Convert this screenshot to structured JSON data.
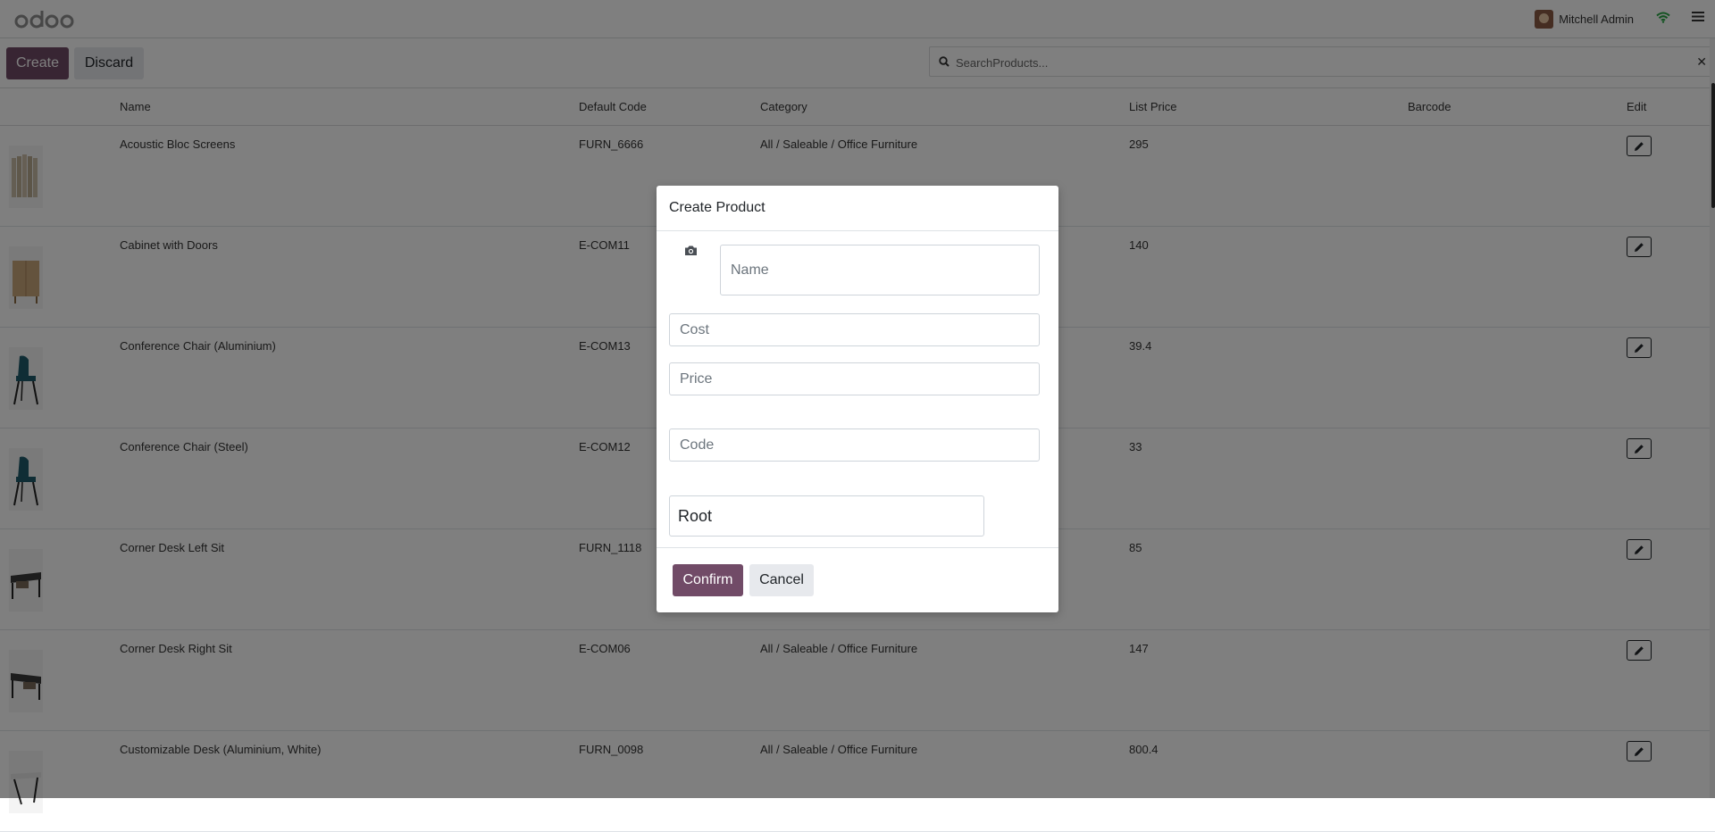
{
  "navbar": {
    "logo_text": "odoo",
    "user_name": "Mitchell Admin",
    "icons": {
      "wifi": "wifi-icon",
      "menu": "hamburger-menu-icon"
    }
  },
  "controls": {
    "create_label": "Create",
    "discard_label": "Discard",
    "search_placeholder": "SearchProducts..."
  },
  "table": {
    "columns": [
      "Name",
      "Default Code",
      "Category",
      "List Price",
      "Barcode",
      "Edit"
    ],
    "rows": [
      {
        "name": "Acoustic Bloc Screens",
        "code": "FURN_6666",
        "category": "All / Saleable / Office Furniture",
        "price": "295",
        "barcode": ""
      },
      {
        "name": "Cabinet with Doors",
        "code": "E-COM11",
        "category": "",
        "price": "140",
        "barcode": ""
      },
      {
        "name": "Conference Chair (Aluminium)",
        "code": "E-COM13",
        "category": "",
        "price": "39.4",
        "barcode": ""
      },
      {
        "name": "Conference Chair (Steel)",
        "code": "E-COM12",
        "category": "",
        "price": "33",
        "barcode": ""
      },
      {
        "name": "Corner Desk Left Sit",
        "code": "FURN_1118",
        "category": "",
        "price": "85",
        "barcode": ""
      },
      {
        "name": "Corner Desk Right Sit",
        "code": "E-COM06",
        "category": "All / Saleable / Office Furniture",
        "price": "147",
        "barcode": ""
      },
      {
        "name": "Customizable Desk (Aluminium, White)",
        "code": "FURN_0098",
        "category": "All / Saleable / Office Furniture",
        "price": "800.4",
        "barcode": ""
      }
    ]
  },
  "modal": {
    "title": "Create Product",
    "name_placeholder": "Name",
    "cost_placeholder": "Cost",
    "price_placeholder": "Price",
    "code_placeholder": "Code",
    "category_value": "Root",
    "confirm_label": "Confirm",
    "cancel_label": "Cancel"
  },
  "colors": {
    "brand": "#714b67",
    "wifi": "#28a745"
  }
}
